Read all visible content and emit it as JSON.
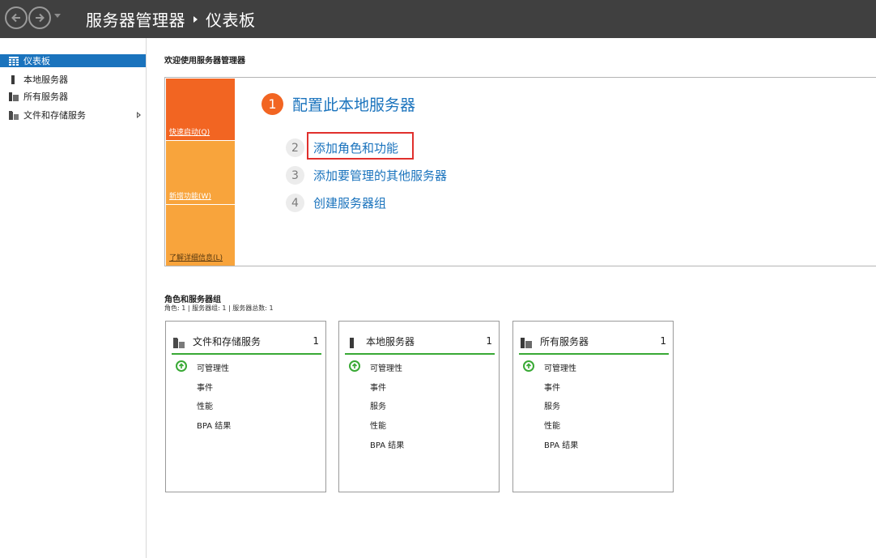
{
  "window": {
    "title": "服务器管理器",
    "current_page": "仪表板"
  },
  "sidebar": {
    "items": [
      {
        "label": "仪表板",
        "icon": "dashboard-icon"
      },
      {
        "label": "本地服务器",
        "icon": "server-icon"
      },
      {
        "label": "所有服务器",
        "icon": "servers-icon"
      },
      {
        "label": "文件和存储服务",
        "icon": "file-storage-icon"
      }
    ]
  },
  "main": {
    "welcome": "欢迎使用服务器管理器",
    "tiles": [
      "快速启动(Q)",
      "新增功能(W)",
      "了解详细信息(L)"
    ],
    "steps": [
      {
        "num": "1",
        "label": "配置此本地服务器"
      },
      {
        "num": "2",
        "label": "添加角色和功能"
      },
      {
        "num": "3",
        "label": "添加要管理的其他服务器"
      },
      {
        "num": "4",
        "label": "创建服务器组"
      }
    ],
    "roles_title": "角色和服务器组",
    "roles_summary": "角色: 1 | 服务器组: 1 | 服务器总数: 1",
    "cards": [
      {
        "title": "文件和存储服务",
        "count": "1",
        "rows": [
          "可管理性",
          "事件",
          "性能",
          "BPA 结果"
        ]
      },
      {
        "title": "本地服务器",
        "count": "1",
        "rows": [
          "可管理性",
          "事件",
          "服务",
          "性能",
          "BPA 结果"
        ]
      },
      {
        "title": "所有服务器",
        "count": "1",
        "rows": [
          "可管理性",
          "事件",
          "服务",
          "性能",
          "BPA 结果"
        ]
      }
    ]
  },
  "colors": {
    "titlebar": "#404040",
    "accent_blue": "#1a73bd",
    "orange": "#f26522",
    "light_orange": "#f8a43c",
    "status_green": "#39a935",
    "highlight_red": "#e0302d"
  }
}
